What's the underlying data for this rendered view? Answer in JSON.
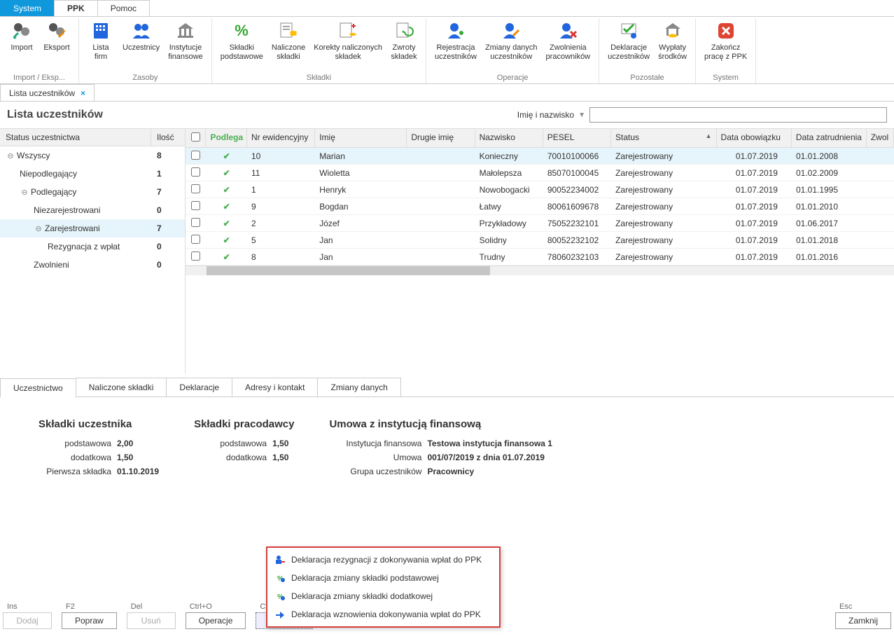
{
  "top_tabs": {
    "system": "System",
    "ppk": "PPK",
    "pomoc": "Pomoc"
  },
  "ribbon": {
    "groups": [
      {
        "label": "Import / Eksp...",
        "items": [
          {
            "id": "import-icon",
            "label": "Import"
          },
          {
            "id": "eksport-icon",
            "label": "Eksport"
          }
        ]
      },
      {
        "label": "Zasoby",
        "items": [
          {
            "id": "lista-firm-icon",
            "label": "Lista\nfirm"
          },
          {
            "id": "uczestnicy-icon",
            "label": "Uczestnicy"
          },
          {
            "id": "instytucje-icon",
            "label": "Instytucje\nfinansowe"
          }
        ]
      },
      {
        "label": "Składki",
        "items": [
          {
            "id": "skladki-podst-icon",
            "label": "Składki\npodstawowe"
          },
          {
            "id": "naliczone-icon",
            "label": "Naliczone\nskładki"
          },
          {
            "id": "korekty-icon",
            "label": "Korekty naliczonych\nskładek"
          },
          {
            "id": "zwroty-icon",
            "label": "Zwroty\nskładek"
          }
        ]
      },
      {
        "label": "Operacje",
        "items": [
          {
            "id": "rejestracja-icon",
            "label": "Rejestracja\nuczestników"
          },
          {
            "id": "zmiany-danych-icon",
            "label": "Zmiany danych\nuczestników"
          },
          {
            "id": "zwolnienia-icon",
            "label": "Zwolnienia\npracowników"
          }
        ]
      },
      {
        "label": "Pozostałe",
        "items": [
          {
            "id": "deklaracje-icon",
            "label": "Deklaracje\nuczestników"
          },
          {
            "id": "wyplaty-icon",
            "label": "Wypłaty\nśrodków"
          }
        ]
      },
      {
        "label": "System",
        "items": [
          {
            "id": "zakoncz-icon",
            "label": "Zakończ\npracę z PPK"
          }
        ]
      }
    ]
  },
  "doc_tab": {
    "label": "Lista uczestników"
  },
  "page_title": "Lista uczestników",
  "search": {
    "label": "Imię i nazwisko",
    "value": ""
  },
  "sidebar": {
    "head_a": "Status uczestnictwa",
    "head_b": "Ilość",
    "rows": [
      {
        "label": "Wszyscy",
        "count": "8",
        "indent": 0,
        "exp": true
      },
      {
        "label": "Niepodlegający",
        "count": "1",
        "indent": 1,
        "exp": false
      },
      {
        "label": "Podlegający",
        "count": "7",
        "indent": 1,
        "exp": true
      },
      {
        "label": "Niezarejestrowani",
        "count": "0",
        "indent": 2,
        "exp": false
      },
      {
        "label": "Zarejestrowani",
        "count": "7",
        "indent": 2,
        "exp": true,
        "selected": true
      },
      {
        "label": "Rezygnacja z wpłat",
        "count": "0",
        "indent": 3,
        "exp": false
      },
      {
        "label": "Zwolnieni",
        "count": "0",
        "indent": 2,
        "exp": false
      }
    ]
  },
  "grid": {
    "headers": {
      "podlega": "Podlega",
      "nr": "Nr ewidencyjny",
      "imie": "Imię",
      "drugie": "Drugie imię",
      "nazwisko": "Nazwisko",
      "pesel": "PESEL",
      "status": "Status",
      "data_ob": "Data obowiązku",
      "data_zat": "Data zatrudnienia",
      "zwol": "Zwol"
    },
    "rows": [
      {
        "nr": "10",
        "imie": "Marian",
        "drugie": "",
        "nazwisko": "Konieczny",
        "pesel": "70010100066",
        "status": "Zarejestrowany",
        "dob": "01.07.2019",
        "dzat": "01.01.2008",
        "sel": true
      },
      {
        "nr": "11",
        "imie": "Wioletta",
        "drugie": "",
        "nazwisko": "Małolepsza",
        "pesel": "85070100045",
        "status": "Zarejestrowany",
        "dob": "01.07.2019",
        "dzat": "01.02.2009"
      },
      {
        "nr": "1",
        "imie": "Henryk",
        "drugie": "",
        "nazwisko": "Nowobogacki",
        "pesel": "90052234002",
        "status": "Zarejestrowany",
        "dob": "01.07.2019",
        "dzat": "01.01.1995"
      },
      {
        "nr": "9",
        "imie": "Bogdan",
        "drugie": "",
        "nazwisko": "Łatwy",
        "pesel": "80061609678",
        "status": "Zarejestrowany",
        "dob": "01.07.2019",
        "dzat": "01.01.2010"
      },
      {
        "nr": "2",
        "imie": "Józef",
        "drugie": "",
        "nazwisko": "Przykładowy",
        "pesel": "75052232101",
        "status": "Zarejestrowany",
        "dob": "01.07.2019",
        "dzat": "01.06.2017"
      },
      {
        "nr": "5",
        "imie": "Jan",
        "drugie": "",
        "nazwisko": "Solidny",
        "pesel": "80052232102",
        "status": "Zarejestrowany",
        "dob": "01.07.2019",
        "dzat": "01.01.2018"
      },
      {
        "nr": "8",
        "imie": "Jan",
        "drugie": "",
        "nazwisko": "Trudny",
        "pesel": "78060232103",
        "status": "Zarejestrowany",
        "dob": "01.07.2019",
        "dzat": "01.01.2016"
      }
    ]
  },
  "lower_tabs": [
    "Uczestnictwo",
    "Naliczone składki",
    "Deklaracje",
    "Adresy i kontakt",
    "Zmiany danych"
  ],
  "detail": {
    "col1_title": "Składki uczestnika",
    "col1": [
      {
        "lbl": "podstawowa",
        "val": "2,00"
      },
      {
        "lbl": "dodatkowa",
        "val": "1,50"
      },
      {
        "lbl": "Pierwsza składka",
        "val": "01.10.2019"
      }
    ],
    "col2_title": "Składki pracodawcy",
    "col2": [
      {
        "lbl": "podstawowa",
        "val": "1,50"
      },
      {
        "lbl": "dodatkowa",
        "val": "1,50"
      }
    ],
    "col3_title": "Umowa z instytucją finansową",
    "col3": [
      {
        "lbl": "Instytucja finansowa",
        "val": "Testowa instytucja finansowa 1"
      },
      {
        "lbl": "Umowa",
        "val": "001/07/2019 z dnia 01.07.2019"
      },
      {
        "lbl": "Grupa uczestników",
        "val": "Pracownicy"
      }
    ]
  },
  "ctx_menu": [
    "Deklaracja rezygnacji z dokonywania wpłat do PPK",
    "Deklaracja zmiany składki podstawowej",
    "Deklaracja zmiany składki dodatkowej",
    "Deklaracja wznowienia dokonywania wpłat do PPK"
  ],
  "bottom": {
    "ins": "Ins",
    "f2": "F2",
    "del": "Del",
    "ctrlo": "Ctrl+O",
    "ctrlw": "Ctrl+W",
    "esc": "Esc",
    "dodaj": "Dodaj",
    "popraw": "Popraw",
    "usun": "Usuń",
    "operacje": "Operacje",
    "wydruki": "Wydruki",
    "zamknij": "Zamknij"
  }
}
